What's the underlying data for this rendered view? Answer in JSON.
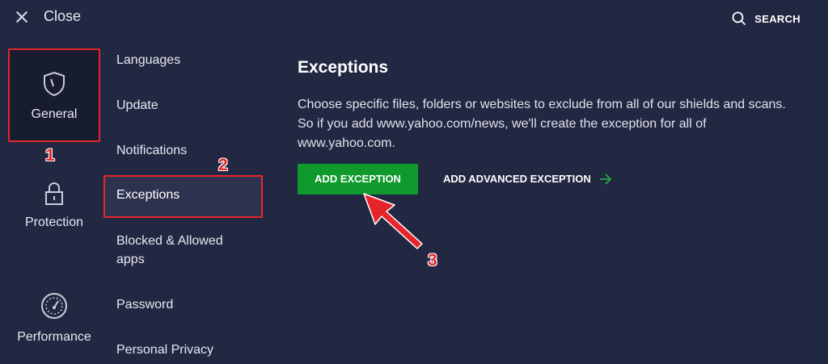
{
  "topbar": {
    "close_label": "Close",
    "search_label": "SEARCH"
  },
  "left_rail": {
    "items": [
      {
        "label": "General",
        "icon": "shield-icon"
      },
      {
        "label": "Protection",
        "icon": "lock-icon"
      },
      {
        "label": "Performance",
        "icon": "gauge-icon"
      }
    ]
  },
  "menu": {
    "items": [
      {
        "label": "Languages"
      },
      {
        "label": "Update"
      },
      {
        "label": "Notifications"
      },
      {
        "label": "Exceptions"
      },
      {
        "label": "Blocked & Allowed",
        "label2": "apps"
      },
      {
        "label": "Password"
      },
      {
        "label": "Personal Privacy"
      }
    ]
  },
  "main": {
    "title": "Exceptions",
    "description_line1": "Choose specific files, folders or websites to exclude from all of our shields and scans.",
    "description_line2": "So if you add www.yahoo.com/news, we'll create the exception for all of",
    "description_line3": "www.yahoo.com.",
    "add_button": "ADD EXCEPTION",
    "advanced_button": "ADD ADVANCED EXCEPTION"
  },
  "annotations": {
    "step1": "1",
    "step2": "2",
    "step3": "3"
  },
  "colors": {
    "background": "#232842",
    "accent_green": "#109a2e",
    "highlight_red": "#e5252a",
    "arrow_green": "#2fb34a"
  }
}
